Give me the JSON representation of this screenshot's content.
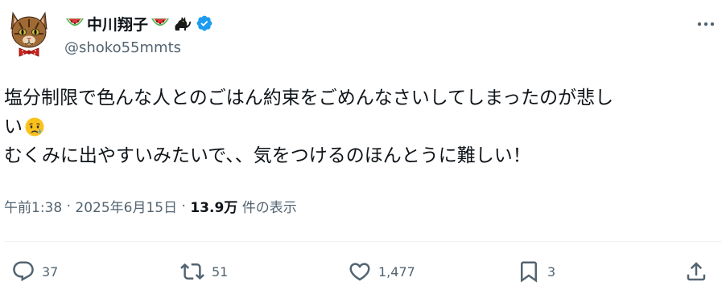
{
  "author": {
    "display_name": "中川翔子",
    "handle": "@shoko55mmts",
    "verified": true,
    "name_emojis": [
      "watermelon-icon",
      "watermelon-icon",
      "black-cat-icon"
    ],
    "avatar": "cat-avatar"
  },
  "tweet": {
    "lines": [
      "塩分制限で色んな人とのごはん約束をごめんなさいしてしまったのが悲し",
      "い",
      "むくみに出やすいみたいで、、気をつけるのほんとうに難しい！"
    ],
    "emoji_after_line_2": "crying-face-icon"
  },
  "meta": {
    "time": "午前1:38",
    "separator": " · ",
    "date": "2025年6月15日",
    "views_count": "13.9万",
    "views_label": " 件の表示"
  },
  "actions": {
    "reply_count": "37",
    "retweet_count": "51",
    "like_count": "1,477",
    "bookmark_count": "3"
  },
  "colors": {
    "text_primary": "#0f1419",
    "text_secondary": "#536471",
    "verified_blue": "#1d9bf0",
    "divider": "#eff3f4"
  }
}
